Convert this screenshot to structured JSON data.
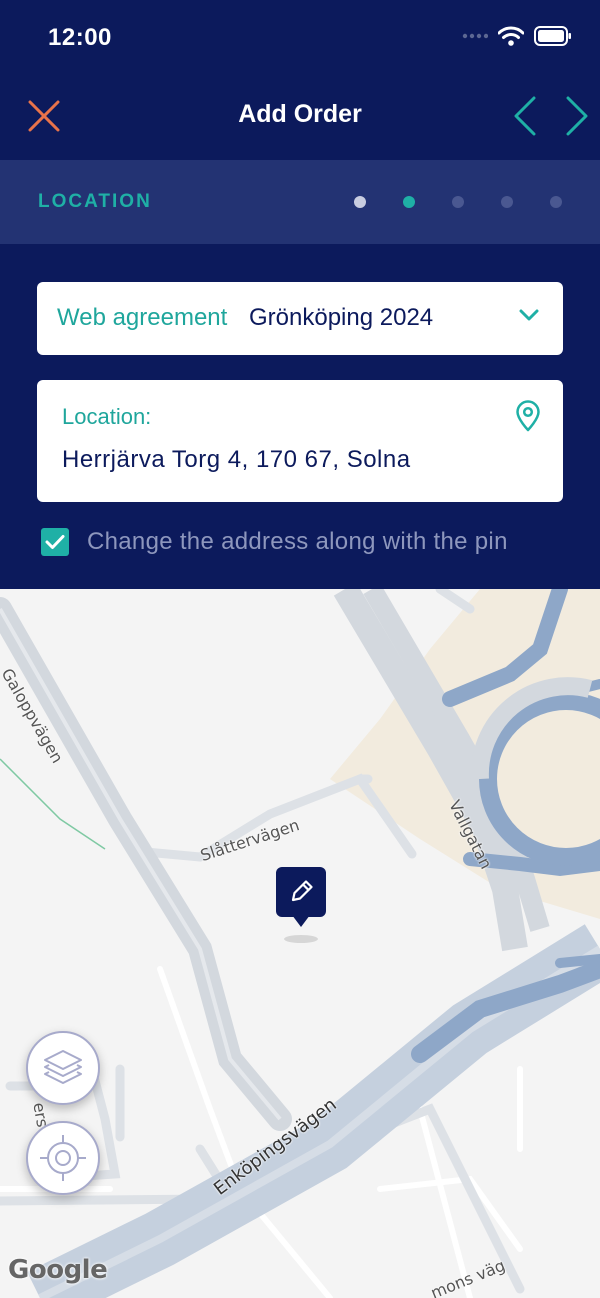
{
  "status_bar": {
    "time": "12:00"
  },
  "nav": {
    "title": "Add Order"
  },
  "step": {
    "label": "LOCATION",
    "total_steps": 5,
    "current_step": 2
  },
  "agreement": {
    "label": "Web agreement",
    "value": "Grönköping 2024"
  },
  "location": {
    "label": "Location:",
    "address": "Herrjärva Torg 4, 170 67, Solna"
  },
  "address_sync": {
    "label": "Change the address along with the pin",
    "checked": true
  },
  "map": {
    "roads": {
      "galoppvagen": "Galoppvägen",
      "slattervagen": "Slåttervägen",
      "vallgatan": "Vallgatan",
      "enkopingsvagen": "Enköpingsvägen",
      "partial_bottom": "mons väg",
      "partial_left": "ers"
    },
    "attribution": "Google"
  },
  "colors": {
    "navy": "#0c1a5c",
    "teal": "#1fb0a6",
    "close_orange": "#e8734a"
  }
}
